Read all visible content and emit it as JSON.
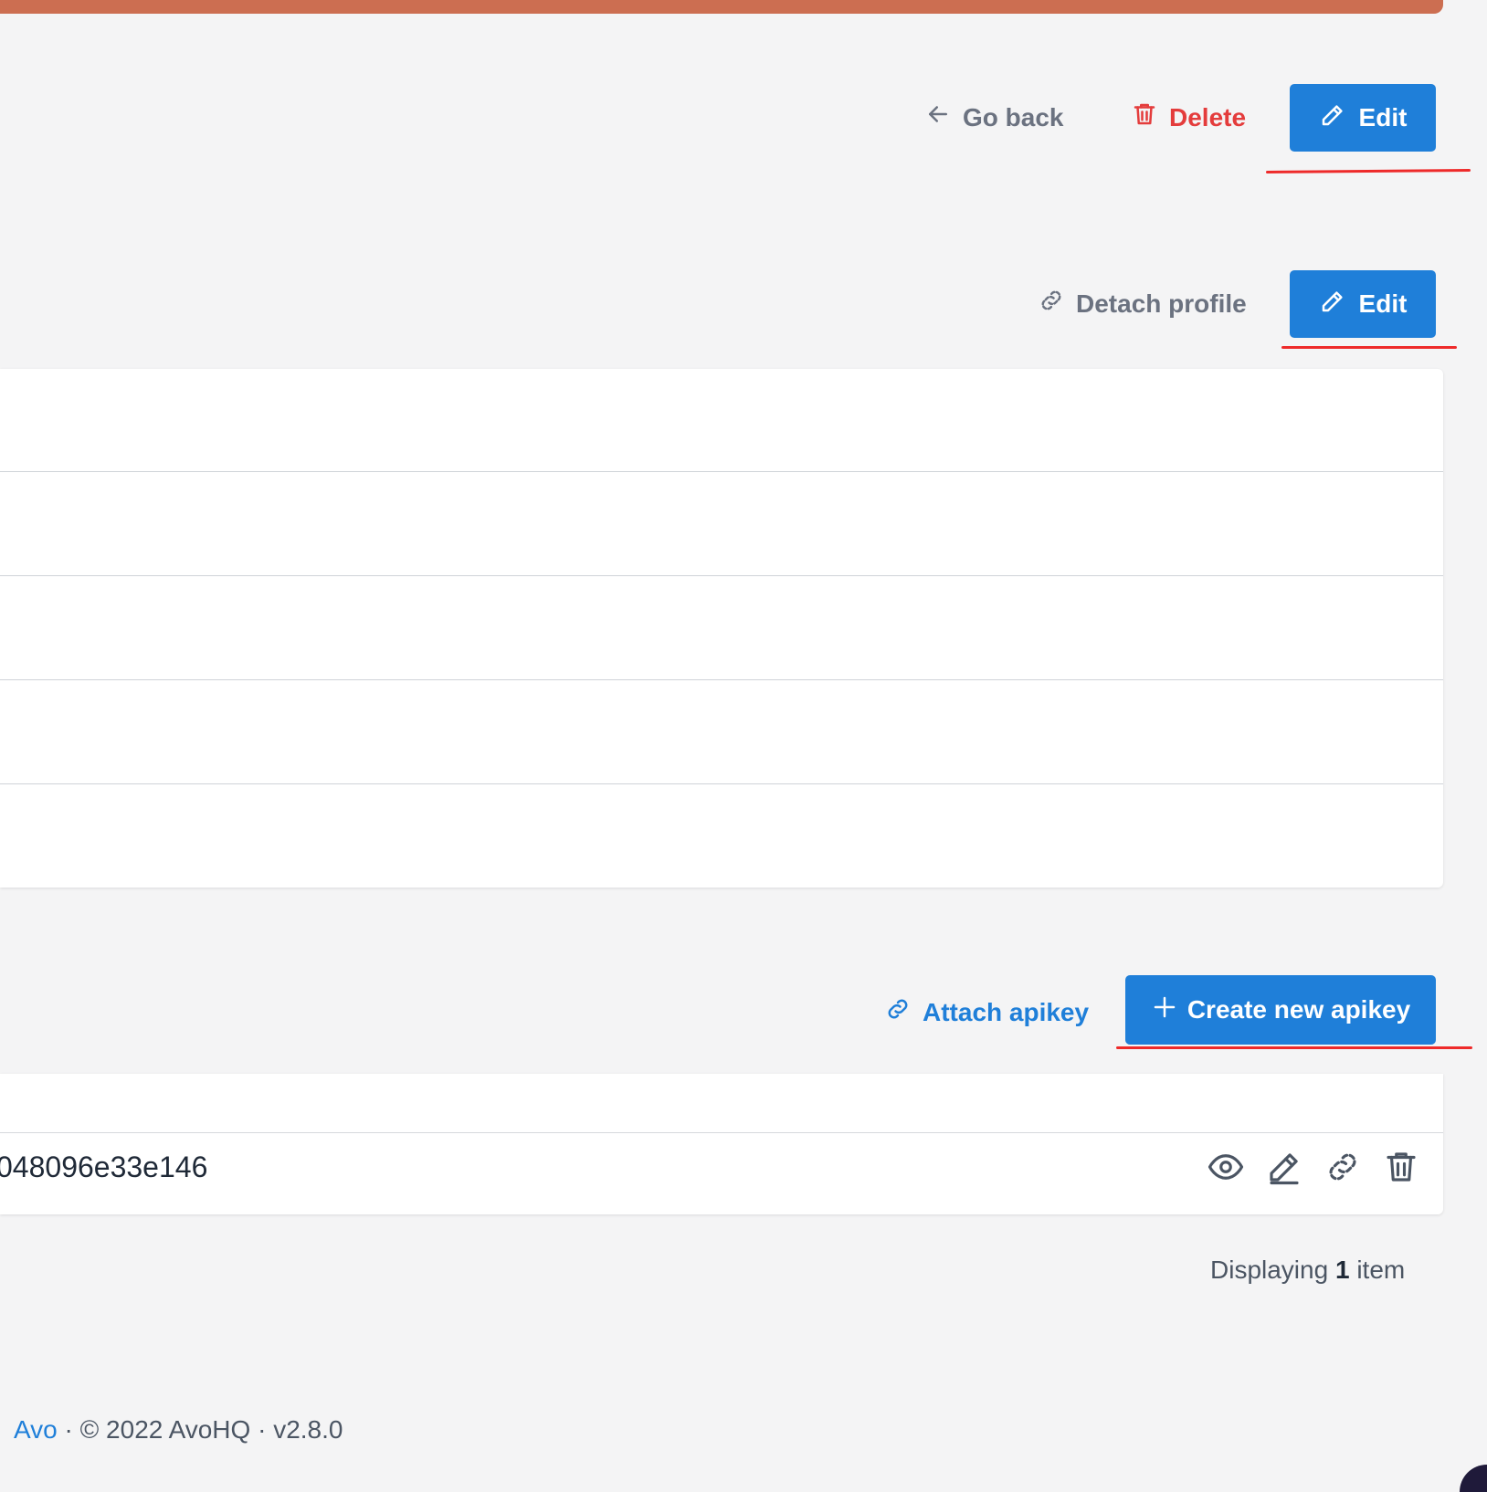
{
  "header_actions": {
    "go_back": "Go back",
    "delete": "Delete",
    "edit": "Edit"
  },
  "profile_section": {
    "detach": "Detach profile",
    "edit": "Edit"
  },
  "apikeys_section": {
    "attach": "Attach apikey",
    "create": "Create new apikey",
    "rows": [
      {
        "id": "048096e33e146"
      }
    ]
  },
  "pagination": {
    "prefix": "Displaying",
    "count": "1",
    "suffix": "item"
  },
  "footer": {
    "brand": "Avo",
    "rest": " · © 2022 AvoHQ · v2.8.0"
  },
  "colors": {
    "primary": "#1f7fd9",
    "danger": "#e43c3c",
    "top_bar": "#cc6e51",
    "annotation": "#ee2a2a"
  },
  "icons": {
    "go_back": "arrow-left-icon",
    "delete": "trash-icon",
    "edit": "pencil-icon",
    "detach": "unlink-icon",
    "attach": "link-icon",
    "create": "plus-icon",
    "view": "eye-icon"
  }
}
